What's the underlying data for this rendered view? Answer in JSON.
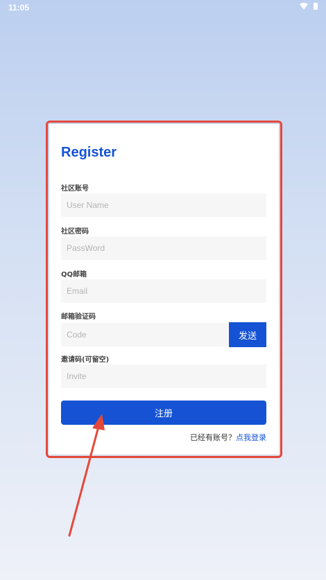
{
  "status_bar": {
    "time": "11:05",
    "wifi_icon": "wifi-icon",
    "battery_icon": "battery-icon"
  },
  "form": {
    "title": "Register",
    "fields": [
      {
        "label": "社区账号",
        "placeholder": "User Name"
      },
      {
        "label": "社区密码",
        "placeholder": "PassWord"
      },
      {
        "label": "QQ邮箱",
        "placeholder": "Email"
      },
      {
        "label": "邮箱验证码",
        "placeholder": "Code"
      },
      {
        "label": "邀请码(可留空)",
        "placeholder": "Invite"
      }
    ],
    "send_label": "发送",
    "register_label": "注册",
    "have_account_text": "已经有账号？",
    "login_link": "点我登录"
  },
  "colors": {
    "accent": "#1553d4",
    "annotation": "#e5483a"
  }
}
